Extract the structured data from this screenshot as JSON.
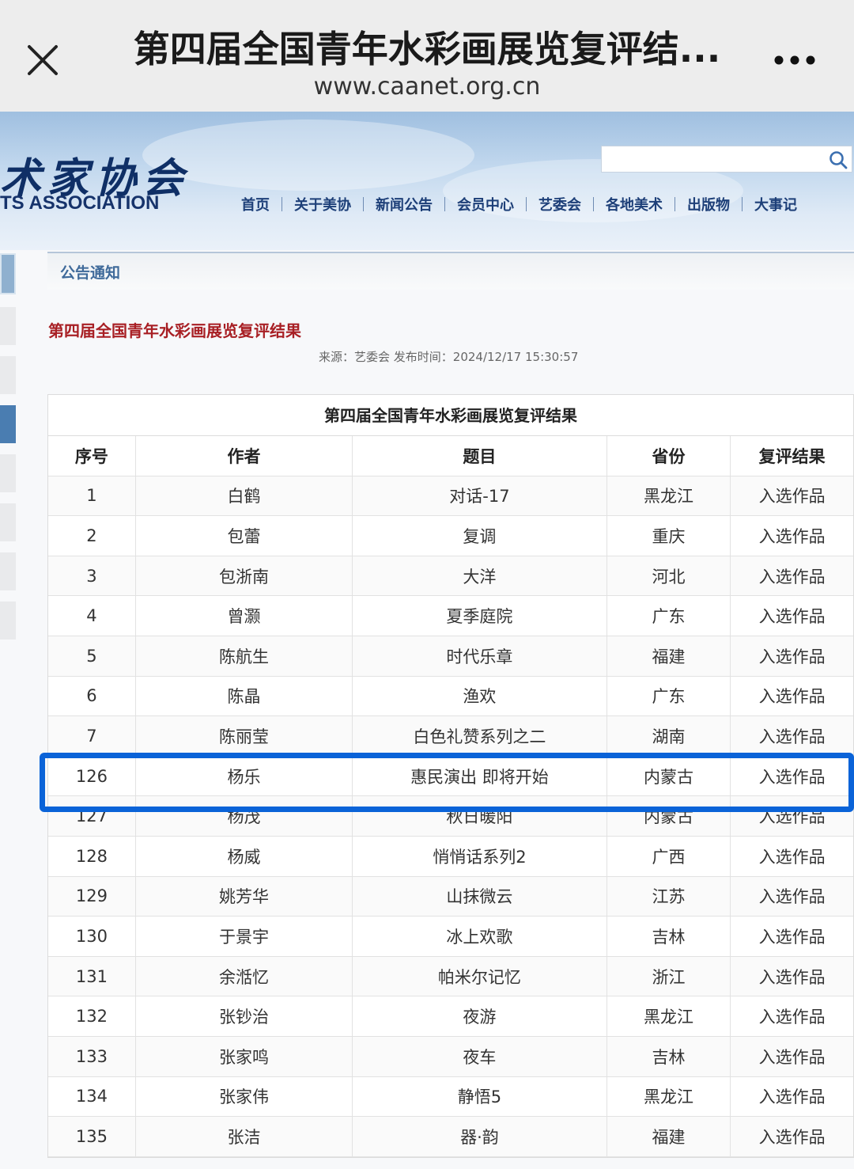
{
  "browser": {
    "title": "第四届全国青年水彩画展览复评结...",
    "url": "www.caanet.org.cn"
  },
  "site": {
    "logo_cn": "术家协会",
    "logo_en": "TS ASSOCIATION",
    "nav": [
      "首页",
      "关于美协",
      "新闻公告",
      "会员中心",
      "艺委会",
      "各地美术",
      "出版物",
      "大事记"
    ]
  },
  "notice": {
    "label": "公告通知",
    "article_title": "第四届全国青年水彩画展览复评结果",
    "meta": "来源：艺委会 发布时间：2024/12/17 15:30:57"
  },
  "table": {
    "caption": "第四届全国青年水彩画展览复评结果",
    "headers": [
      "序号",
      "作者",
      "题目",
      "省份",
      "复评结果"
    ],
    "rows": [
      [
        "1",
        "白鹤",
        "对话-17",
        "黑龙江",
        "入选作品"
      ],
      [
        "2",
        "包蕾",
        "复调",
        "重庆",
        "入选作品"
      ],
      [
        "3",
        "包浙南",
        "大洋",
        "河北",
        "入选作品"
      ],
      [
        "4",
        "曾灏",
        "夏季庭院",
        "广东",
        "入选作品"
      ],
      [
        "5",
        "陈航生",
        "时代乐章",
        "福建",
        "入选作品"
      ],
      [
        "6",
        "陈晶",
        "渔欢",
        "广东",
        "入选作品"
      ],
      [
        "7",
        "陈丽莹",
        "白色礼赞系列之二",
        "湖南",
        "入选作品"
      ],
      [
        "126",
        "杨乐",
        "惠民演出 即将开始",
        "内蒙古",
        "入选作品"
      ],
      [
        "127",
        "杨茂",
        "秋日暖阳",
        "内蒙古",
        "入选作品"
      ],
      [
        "128",
        "杨威",
        "悄悄话系列2",
        "广西",
        "入选作品"
      ],
      [
        "129",
        "姚芳华",
        "山抹微云",
        "江苏",
        "入选作品"
      ],
      [
        "130",
        "于景宇",
        "冰上欢歌",
        "吉林",
        "入选作品"
      ],
      [
        "131",
        "余湉忆",
        "帕米尔记忆",
        "浙江",
        "入选作品"
      ],
      [
        "132",
        "张钞治",
        "夜游",
        "黑龙江",
        "入选作品"
      ],
      [
        "133",
        "张家鸣",
        "夜车",
        "吉林",
        "入选作品"
      ],
      [
        "134",
        "张家伟",
        "静悟5",
        "黑龙江",
        "入选作品"
      ],
      [
        "135",
        "张洁",
        "器·韵",
        "福建",
        "入选作品"
      ]
    ]
  },
  "colors": {
    "highlight": "#0a63d8",
    "title_red": "#a81f24",
    "nav_blue": "#1d3f78"
  }
}
